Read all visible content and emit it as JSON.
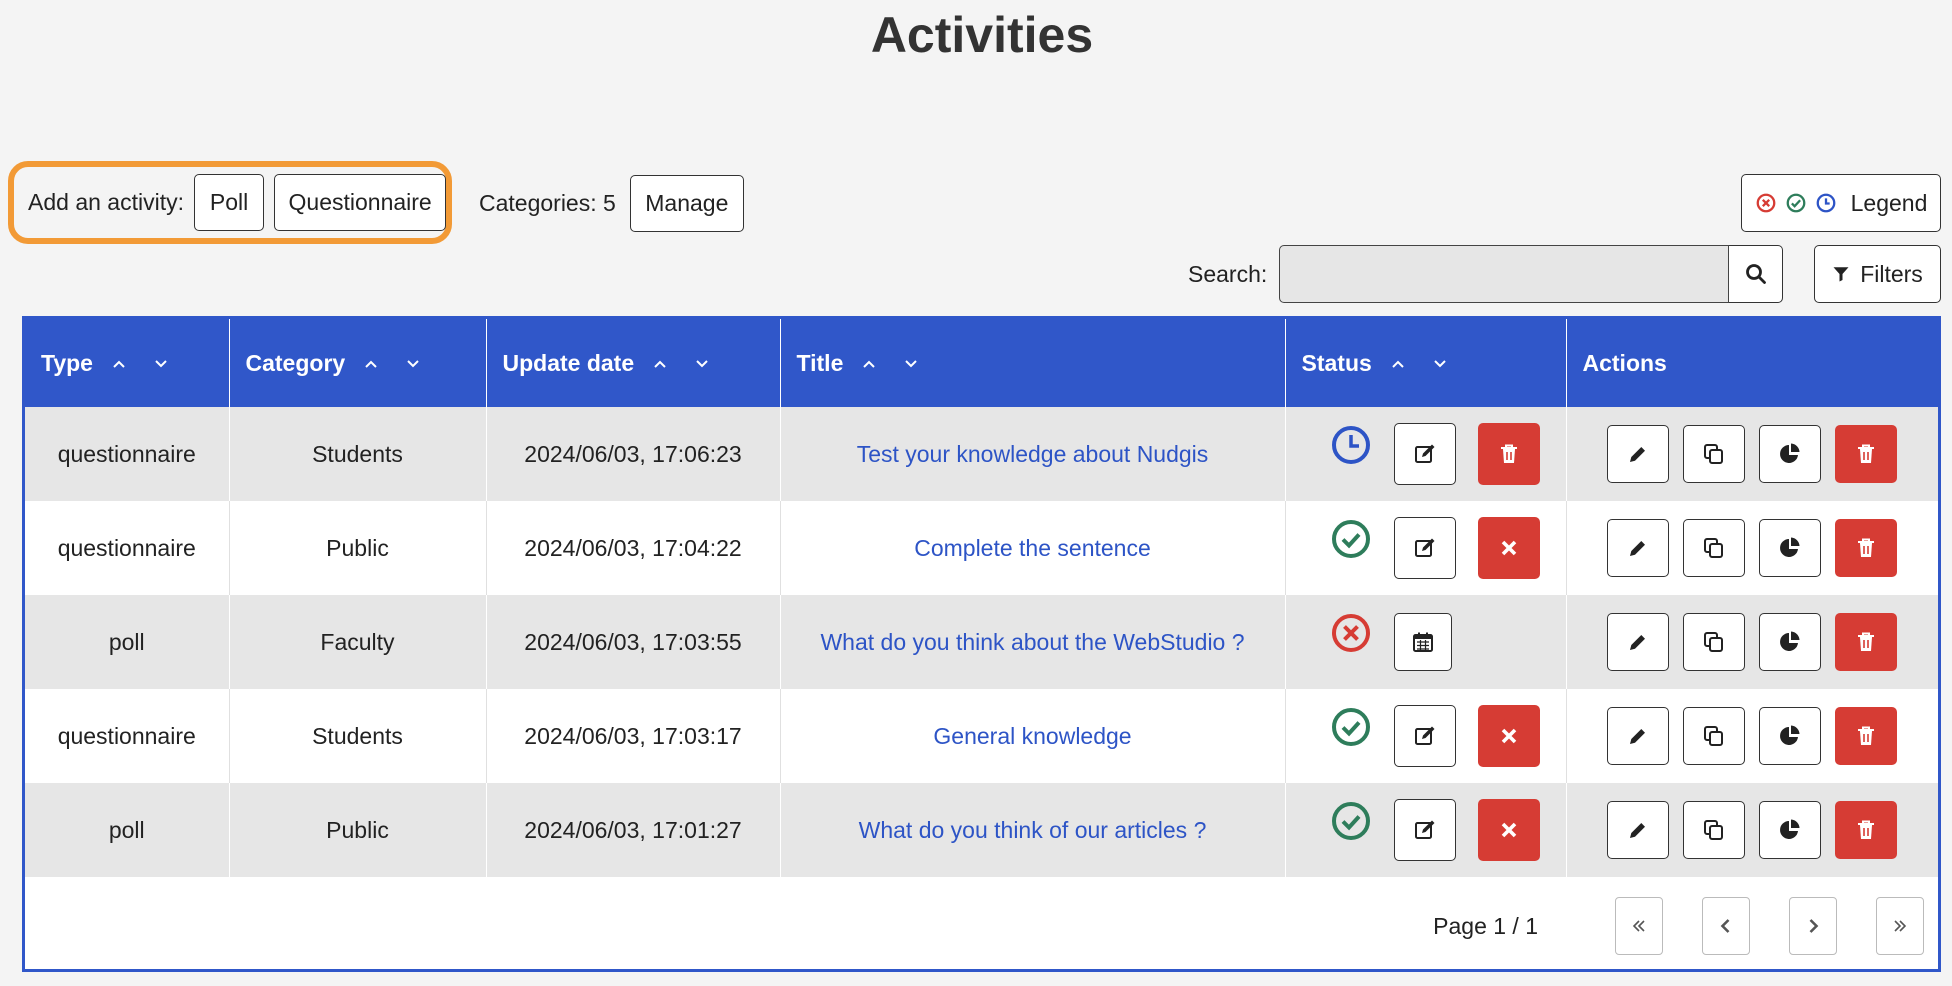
{
  "page_title": "Activities",
  "add_activity": {
    "label": "Add an activity:",
    "poll": "Poll",
    "questionnaire": "Questionnaire"
  },
  "categories": {
    "label": "Categories: 5",
    "manage": "Manage"
  },
  "legend": {
    "label": "Legend"
  },
  "search": {
    "label": "Search:",
    "value": "",
    "placeholder": ""
  },
  "filters": {
    "label": "Filters"
  },
  "table": {
    "columns": [
      "Type",
      "Category",
      "Update date",
      "Title",
      "Status",
      "Actions"
    ],
    "rows": [
      {
        "type": "questionnaire",
        "category": "Students",
        "date": "2024/06/03, 17:06:23",
        "title": "Test your knowledge about Nudgis",
        "status": "scheduled"
      },
      {
        "type": "questionnaire",
        "category": "Public",
        "date": "2024/06/03, 17:04:22",
        "title": "Complete the sentence",
        "status": "active"
      },
      {
        "type": "poll",
        "category": "Faculty",
        "date": "2024/06/03, 17:03:55",
        "title": "What do you think about the WebStudio ?",
        "status": "inactive"
      },
      {
        "type": "questionnaire",
        "category": "Students",
        "date": "2024/06/03, 17:03:17",
        "title": "General knowledge",
        "status": "active"
      },
      {
        "type": "poll",
        "category": "Public",
        "date": "2024/06/03, 17:01:27",
        "title": "What do you think of our articles ?",
        "status": "active"
      }
    ]
  },
  "pager": {
    "label": "Page 1 / 1"
  },
  "colors": {
    "accent": "#3057c9",
    "highlight": "#f29a36",
    "danger": "#d63c34",
    "success": "#2e7d5b",
    "info": "#2d54c6"
  }
}
